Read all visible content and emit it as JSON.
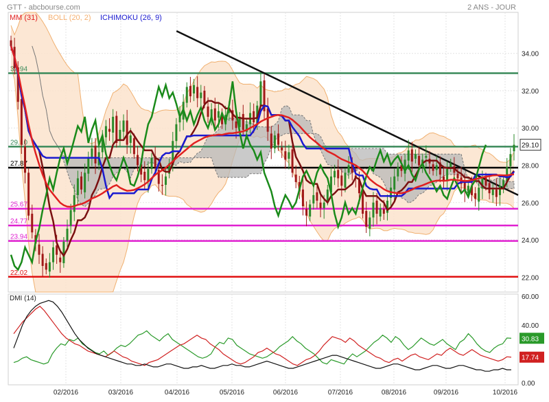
{
  "header": {
    "symbol_source": "GTT - abcbourse.com",
    "period": "2 ANS - JOUR"
  },
  "legend": [
    {
      "label": "MM (31)",
      "color": "#e02020"
    },
    {
      "label": "BOLL (20, 2)",
      "color": "#f5b070"
    },
    {
      "label": "ICHIMOKU (26, 9)",
      "color": "#1a1ad0"
    }
  ],
  "colors": {
    "candle_up": "#2a8a2a",
    "candle_down": "#a01818",
    "mm": "#e02020",
    "boll_fill": "#fbe3cc",
    "boll_edge": "#f0b070",
    "kijun": "#1a1ad0",
    "tenkan": "#7a1010",
    "chikou": "#1a8a1a",
    "cloud": "#b8b8b8",
    "trendline": "#111111",
    "support_green": "#3a8a5a",
    "support_black": "#000000",
    "support_magenta": "#e020d0",
    "support_red": "#e01010",
    "dmi_plus": "#2a9a2a",
    "dmi_minus": "#d02020",
    "adx": "#111111"
  },
  "chart_data": [
    {
      "type": "candlestick",
      "panel": "price",
      "ylim": [
        21.2,
        36.2
      ],
      "yticks": [
        "22.00",
        "24.00",
        "26.00",
        "28.00",
        "30.00",
        "32.00",
        "34.00"
      ],
      "x_labels": [
        "02/2016",
        "03/2016",
        "04/2016",
        "05/2016",
        "06/2016",
        "07/2016",
        "08/2016",
        "09/2016",
        "10/2016"
      ],
      "last_value": "29.10",
      "horizontal_levels": [
        {
          "label": "32.94",
          "value": 32.94,
          "color": "green"
        },
        {
          "label": "29.10",
          "value": 29.0,
          "color": "green"
        },
        {
          "label": "27.87",
          "value": 27.87,
          "color": "black"
        },
        {
          "label": "25.67",
          "value": 25.67,
          "color": "magenta"
        },
        {
          "label": "24.77",
          "value": 24.77,
          "color": "magenta"
        },
        {
          "label": "23.94",
          "value": 23.94,
          "color": "magenta"
        },
        {
          "label": "22.02",
          "value": 22.02,
          "color": "red"
        }
      ],
      "trendline": [
        [
          0.33,
          35.2
        ],
        [
          1.0,
          26.4
        ]
      ],
      "close": [
        34.4,
        33.2,
        31.4,
        29.1,
        27.6,
        25.3,
        24.4,
        23.8,
        23.2,
        22.6,
        22.4,
        22.8,
        23.6,
        23.2,
        22.8,
        23.9,
        24.6,
        25.6,
        26.4,
        27.3,
        26.7,
        27.6,
        28.4,
        28.9,
        28.1,
        28.7,
        29.4,
        30.1,
        29.8,
        30.6,
        29.2,
        29.9,
        30.4,
        29.1,
        29.6,
        28.6,
        28.0,
        27.5,
        27.2,
        27.8,
        28.4,
        27.9,
        27.0,
        26.9,
        27.4,
        28.1,
        29.3,
        30.2,
        30.6,
        31.4,
        32.2,
        31.7,
        32.3,
        31.6,
        31.9,
        31.3,
        30.6,
        31.0,
        30.4,
        30.9,
        30.2,
        30.7,
        31.1,
        30.4,
        30.0,
        30.6,
        29.9,
        30.2,
        30.8,
        30.3,
        31.2,
        32.5,
        30.9,
        29.8,
        28.9,
        29.6,
        29.1,
        28.8,
        28.3,
        28.7,
        27.6,
        27.1,
        26.6,
        25.8,
        25.3,
        25.9,
        26.4,
        26.1,
        25.7,
        26.0,
        26.7,
        27.4,
        27.7,
        27.3,
        26.9,
        27.6,
        28.0,
        27.6,
        27.3,
        26.5,
        25.4,
        24.7,
        25.2,
        26.0,
        25.4,
        25.7,
        25.4,
        26.1,
        26.8,
        27.4,
        27.9,
        27.7,
        28.3,
        28.8,
        28.2,
        28.6,
        28.0,
        28.3,
        28.5,
        28.1,
        27.7,
        28.0,
        27.5,
        27.2,
        27.8,
        28.1,
        27.6,
        27.3,
        27.0,
        26.6,
        26.9,
        26.4,
        26.2,
        26.8,
        27.3,
        26.9,
        26.5,
        26.7,
        26.3,
        26.9,
        27.2,
        27.9,
        28.6,
        29.1
      ]
    },
    {
      "type": "line",
      "panel": "dmi",
      "title": "DMI (14)",
      "ylim": [
        0,
        60
      ],
      "yticks": [
        "0.00",
        "20.00",
        "40.00",
        "60.00"
      ],
      "series": [
        {
          "name": "",
          "role": "dmi_plus",
          "last_label": "30.83",
          "values": [
            14,
            15,
            17,
            18,
            16,
            15,
            14,
            13,
            14,
            20,
            24,
            27,
            26,
            30,
            29,
            31,
            27,
            25,
            23,
            21,
            20,
            22,
            19,
            21,
            24,
            26,
            25,
            27,
            30,
            33,
            34,
            36,
            33,
            31,
            29,
            32,
            34,
            30,
            28,
            26,
            24,
            22,
            20,
            18,
            17,
            18,
            20,
            25,
            28,
            27,
            31,
            30,
            26,
            24,
            22,
            20,
            19,
            18,
            17,
            18,
            20,
            22,
            25,
            27,
            29,
            32,
            29,
            27,
            24,
            22,
            20,
            17,
            14,
            13,
            16,
            15,
            14,
            13,
            17,
            20,
            18,
            20,
            22,
            25,
            28,
            30,
            33,
            31,
            28,
            32,
            30,
            26,
            23,
            25,
            28,
            31,
            29,
            27,
            26,
            28,
            30,
            27,
            25,
            23,
            28,
            30,
            34,
            31,
            27,
            24,
            22,
            21,
            24,
            26,
            27,
            31,
            30.83
          ]
        },
        {
          "name": "",
          "role": "dmi_minus",
          "last_label": "17.74",
          "values": [
            34,
            38,
            42,
            45,
            48,
            51,
            53,
            50,
            46,
            42,
            38,
            34,
            31,
            29,
            27,
            26,
            24,
            22,
            21,
            20,
            19,
            18,
            20,
            22,
            20,
            18,
            17,
            15,
            14,
            13,
            12,
            14,
            15,
            16,
            18,
            20,
            22,
            24,
            26,
            27,
            29,
            31,
            33,
            31,
            30,
            27,
            25,
            23,
            20,
            18,
            16,
            14,
            13,
            14,
            16,
            18,
            21,
            22,
            24,
            22,
            20,
            19,
            17,
            15,
            13,
            12,
            14,
            16,
            17,
            19,
            22,
            26,
            29,
            32,
            31,
            30,
            28,
            31,
            29,
            26,
            24,
            22,
            20,
            18,
            17,
            15,
            14,
            16,
            17,
            15,
            17,
            19,
            20,
            18,
            17,
            16,
            18,
            20,
            19,
            22,
            24,
            22,
            20,
            19,
            21,
            23,
            21,
            19,
            18,
            17,
            16,
            15,
            16,
            18,
            17.74
          ]
        },
        {
          "name": "",
          "role": "adx",
          "last_label": "",
          "values": [
            24,
            32,
            40,
            46,
            50,
            53,
            55,
            56,
            57,
            56,
            53,
            49,
            44,
            39,
            34,
            30,
            27,
            24,
            22,
            20,
            19,
            18,
            17,
            16,
            15,
            14,
            13,
            13,
            12,
            12,
            13,
            12,
            11,
            11,
            12,
            13,
            13,
            12,
            11,
            10,
            10,
            11,
            11,
            12,
            11,
            10,
            10,
            11,
            12,
            12,
            13,
            12,
            12,
            11,
            11,
            12,
            13,
            14,
            15,
            14,
            13,
            12,
            11,
            10,
            10,
            11,
            12,
            13,
            14,
            15,
            16,
            17,
            18,
            19,
            19,
            18,
            17,
            16,
            15,
            14,
            13,
            12,
            11,
            10,
            10,
            11,
            12,
            13,
            13,
            12,
            11,
            10,
            9,
            9,
            10,
            11,
            12,
            12,
            11,
            10,
            10,
            11,
            12,
            12,
            11,
            10,
            9,
            9,
            8,
            8,
            9,
            9,
            10,
            9,
            9
          ]
        }
      ]
    }
  ]
}
